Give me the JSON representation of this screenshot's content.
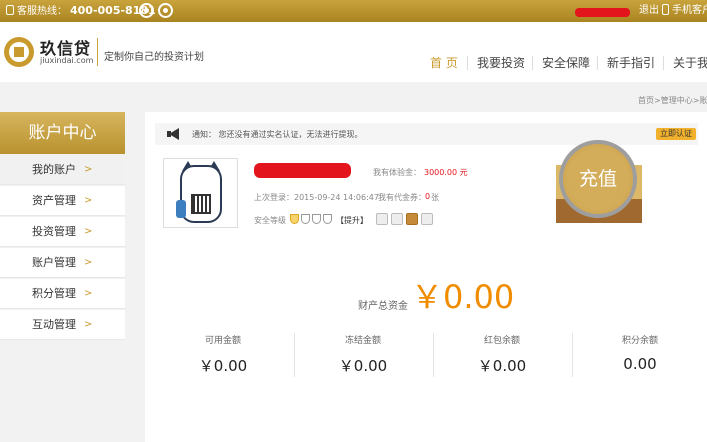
{
  "topbar": {
    "hotline_label": "客服热线：",
    "hotline_number": "400-005-8181",
    "logout": "退出",
    "mobile_client": "手机客户"
  },
  "header": {
    "logo_cn": "玖信贷",
    "logo_en": "jiuxindai.com",
    "slogan": "定制你自己的投资计划"
  },
  "nav": {
    "items": [
      "首 页",
      "我要投资",
      "安全保障",
      "新手指引",
      "关于我"
    ]
  },
  "breadcrumb": "首页>管理中心>账户",
  "sidebar": {
    "title": "账户中心",
    "items": [
      {
        "label": "我的账户",
        "arrow": ">"
      },
      {
        "label": "资产管理",
        "arrow": ">"
      },
      {
        "label": "投资管理",
        "arrow": ">"
      },
      {
        "label": "账户管理",
        "arrow": ">"
      },
      {
        "label": "积分管理",
        "arrow": ">"
      },
      {
        "label": "互动管理",
        "arrow": ">"
      }
    ]
  },
  "notice": {
    "text": "通知： 您还没有通过实名认证，无法进行提现。",
    "verify_button": "立即认证"
  },
  "account": {
    "experience_label": "我有体验金：",
    "experience_value": "3000.00 元",
    "last_login": "上次登录：2015-09-24 14:06:47",
    "coupon_label": "我有代金券：",
    "coupon_value": "0",
    "coupon_unit": "张",
    "security_label": "安全等级",
    "upgrade": "【提升】",
    "recharge": "充值"
  },
  "assets": {
    "total_label": "财产总资金",
    "total_value": "￥0.00",
    "columns": [
      {
        "label": "可用金额",
        "value": "￥0.00"
      },
      {
        "label": "冻结金额",
        "value": "￥0.00"
      },
      {
        "label": "红包余额",
        "value": "￥0.00"
      },
      {
        "label": "积分余额",
        "value": "0.00"
      }
    ]
  },
  "colors": {
    "gold": "#c99a2e",
    "orange": "#f08c00",
    "red": "#e3141c"
  }
}
